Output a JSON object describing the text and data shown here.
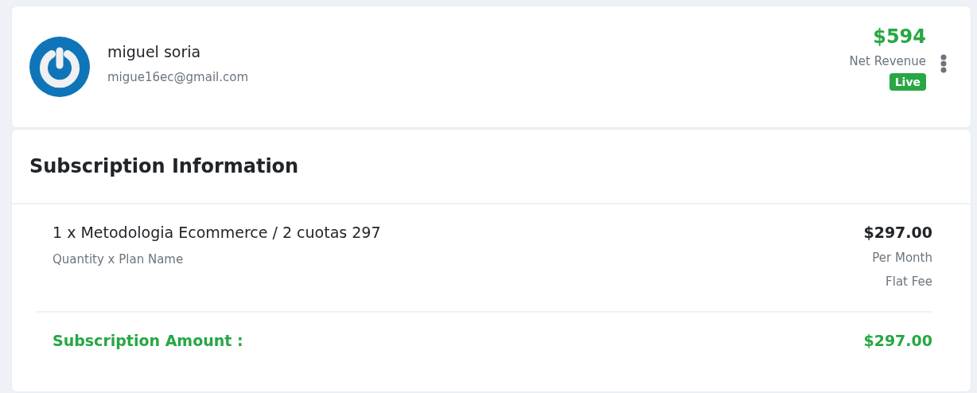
{
  "customer": {
    "name": "miguel soria",
    "email": "migue16ec@gmail.com",
    "revenue": "$594",
    "revenue_label": "Net Revenue",
    "status": "Live"
  },
  "subscription": {
    "title": "Subscription Information",
    "items": [
      {
        "name": "1 x Metodologia Ecommerce / 2 cuotas 297",
        "caption": "Quantity x Plan Name",
        "price": "$297.00",
        "period": "Per Month",
        "fee_type": "Flat Fee"
      }
    ],
    "total_label": "Subscription Amount :",
    "total": "$297.00"
  }
}
